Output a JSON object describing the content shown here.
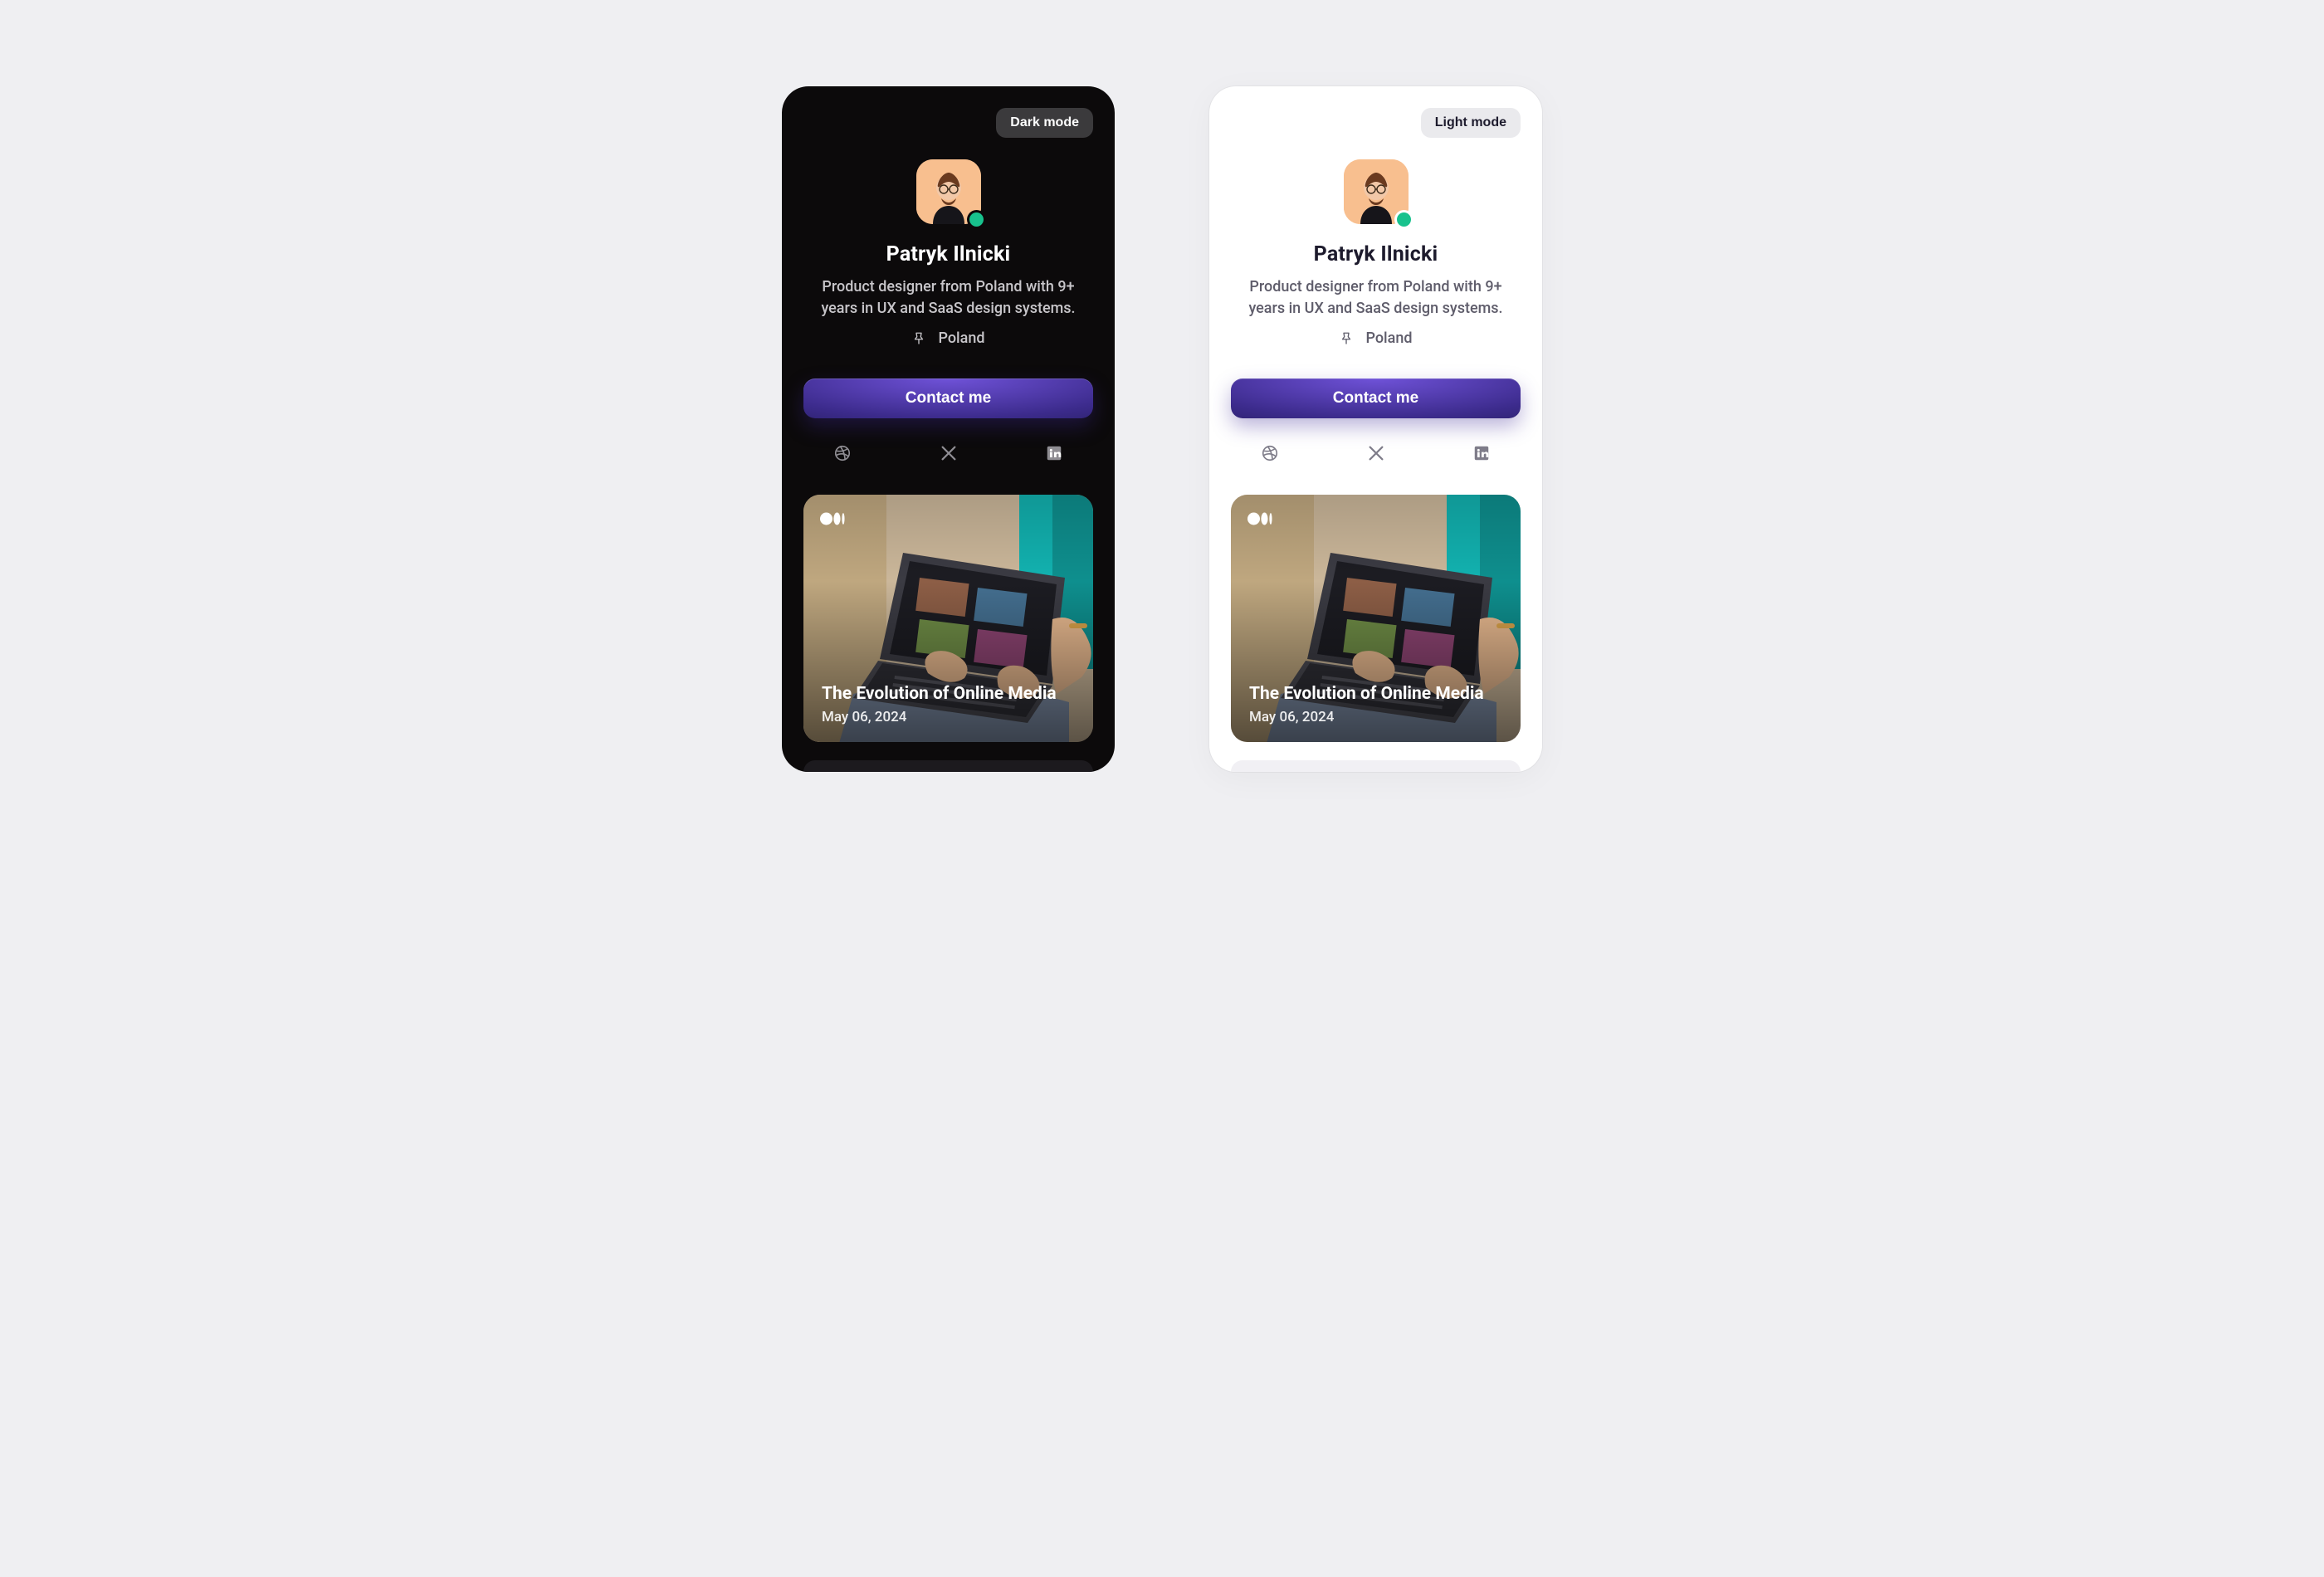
{
  "profile": {
    "name": "Patryk Ilnicki",
    "bio": "Product designer from Poland with 9+ years in UX and SaaS design systems.",
    "location": "Poland",
    "contact_label": "Contact me",
    "status_color": "#18C28D",
    "avatar_bg": "#F8BF8F"
  },
  "cards": {
    "dark": {
      "theme_label": "Dark mode"
    },
    "light": {
      "theme_label": "Light mode"
    }
  },
  "socials": [
    {
      "name": "dribbble"
    },
    {
      "name": "x-twitter"
    },
    {
      "name": "linkedin"
    }
  ],
  "article": {
    "platform": "medium",
    "title": "The Evolution of Online Media",
    "date": "May 06, 2024"
  },
  "colors": {
    "cta_gradient_top": "#6F52D8",
    "cta_gradient_mid": "#3C2B8C",
    "cta_gradient_bot": "#1E184F",
    "dark_bg": "#0C0A0B",
    "light_bg": "#FFFFFF",
    "page_bg": "#EFEFF2"
  }
}
